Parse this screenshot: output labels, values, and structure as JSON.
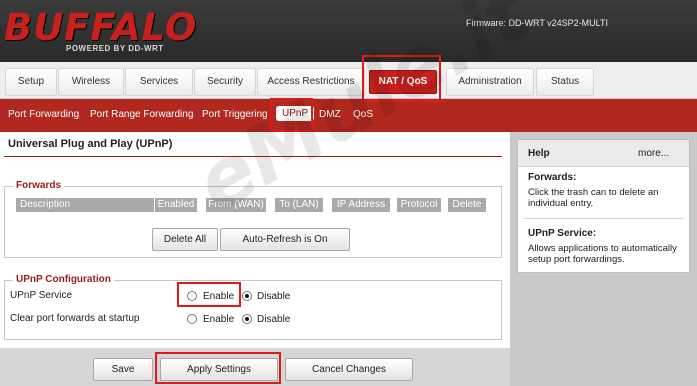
{
  "header": {
    "logo": "BUFFALO",
    "logo_sub": "POWERED BY DD-WRT",
    "firmware": "Firmware: DD-WRT v24SP2-MULTI"
  },
  "main_tabs": [
    "Setup",
    "Wireless",
    "Services",
    "Security",
    "Access Restrictions",
    "NAT / QoS",
    "Administration",
    "Status"
  ],
  "active_main_tab": "NAT / QoS",
  "sub_tabs": [
    "Port Forwarding",
    "Port Range Forwarding",
    "Port Triggering",
    "UPnP",
    "DMZ",
    "QoS"
  ],
  "active_sub_tab": "UPnP",
  "page_title": "Universal Plug and Play (UPnP)",
  "forwards": {
    "legend": "Forwards",
    "columns": [
      "Description",
      "Enabled",
      "From (WAN)",
      "To (LAN)",
      "IP Address",
      "Protocol",
      "Delete"
    ],
    "delete_all": "Delete All",
    "auto_refresh": "Auto-Refresh is On"
  },
  "upnp_config": {
    "legend": "UPnP Configuration",
    "rows": [
      {
        "label": "UPnP Service",
        "enable": "Enable",
        "disable": "Disable",
        "selected": "Disable"
      },
      {
        "label": "Clear port forwards at startup",
        "enable": "Enable",
        "disable": "Disable",
        "selected": "Disable"
      }
    ]
  },
  "footer": {
    "save": "Save",
    "apply": "Apply Settings",
    "cancel": "Cancel Changes"
  },
  "help": {
    "title": "Help",
    "more": "more...",
    "sections": [
      {
        "heading": "Forwards:",
        "text": "Click the trash can to delete an individual entry."
      },
      {
        "heading": "UPnP Service:",
        "text": "Allows applications to automatically setup port forwardings."
      }
    ]
  },
  "watermark": "eMule.it",
  "colors": {
    "brand_red": "#c8201c",
    "subnav_red": "#b0281f",
    "highlight": "#e0191b"
  }
}
